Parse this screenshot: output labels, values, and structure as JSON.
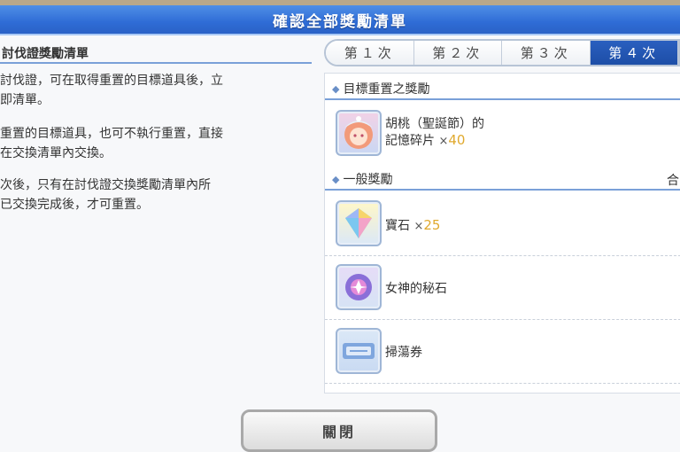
{
  "title": "確認全部獎勵清單",
  "left": {
    "heading": "討伐證獎勵清單",
    "rules": [
      "討伐證，可在取得重置的目標道具後，立\n即清單。",
      "重置的目標道具，也可不執行重置，直接\n在交換清單內交換。",
      "次後，只有在討伐證交換獎勵清單內所\n已交換完成後，才可重置。"
    ]
  },
  "tabs": [
    "第１次",
    "第２次",
    "第３次",
    "第４次"
  ],
  "active_tab_index": 3,
  "sections": {
    "target": {
      "label": "目標重置之獎勵"
    },
    "general": {
      "label": "一般獎勵",
      "extra": "合"
    }
  },
  "items": {
    "target_item": {
      "name_line1": "胡桃（聖誕節）的",
      "name_line2": "記憶碎片",
      "qty_prefix": "×",
      "qty": "40",
      "icon": "character-portrait-icon"
    },
    "gem": {
      "name": "寶石",
      "qty_prefix": "×",
      "qty": "25",
      "icon": "gem-icon"
    },
    "stone": {
      "name": "女神的秘石",
      "icon": "goddess-stone-icon"
    },
    "ticket": {
      "name": "掃蕩券",
      "icon": "sweep-ticket-icon"
    }
  },
  "close_label": "關閉",
  "colors": {
    "title_bar": "#2f6cd6",
    "active_tab": "#1d4ea7",
    "qty": "#e0a92e"
  }
}
